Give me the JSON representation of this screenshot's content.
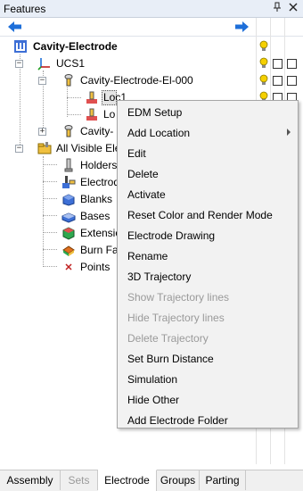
{
  "panel": {
    "title": "Features",
    "pin_icon": "pin-icon",
    "close_icon": "close-icon"
  },
  "nav": {
    "back_icon": "arrow-left-icon",
    "forward_icon": "arrow-right-icon",
    "bulb_icon": "lightbulb-icon"
  },
  "tree": {
    "root": "Cavity-Electrode",
    "ucs": "UCS1",
    "electrode_group": "Cavity-Electrode-El-000",
    "loc1": "Loc1",
    "loc2": "Lo",
    "cavity2": "Cavity-",
    "all_visible": "All Visible Ele",
    "holders": "Holders",
    "electrodes": "Electrod",
    "blanks": "Blanks",
    "bases": "Bases",
    "extensions": "Extensio",
    "burn_faces": "Burn Fa",
    "points": "Points"
  },
  "context_menu": {
    "items": [
      {
        "label": "EDM Setup",
        "enabled": true
      },
      {
        "label": "Add Location",
        "enabled": true,
        "submenu": true
      },
      {
        "label": "Edit",
        "enabled": true
      },
      {
        "label": "Delete",
        "enabled": true
      },
      {
        "label": "Activate",
        "enabled": true
      },
      {
        "label": "Reset Color and Render Mode",
        "enabled": true
      },
      {
        "label": "Electrode Drawing",
        "enabled": true
      },
      {
        "label": "Rename",
        "enabled": true
      },
      {
        "label": "3D Trajectory",
        "enabled": true
      },
      {
        "label": "Show Trajectory lines",
        "enabled": false
      },
      {
        "label": "Hide Trajectory lines",
        "enabled": false
      },
      {
        "label": "Delete Trajectory",
        "enabled": false
      },
      {
        "label": "Set Burn Distance",
        "enabled": true
      },
      {
        "label": "Simulation",
        "enabled": true
      },
      {
        "label": "Hide Other",
        "enabled": true
      },
      {
        "label": "Add Electrode Folder",
        "enabled": true
      }
    ]
  },
  "tabs": [
    {
      "label": "Assembly",
      "active": false,
      "enabled": true
    },
    {
      "label": "Sets",
      "active": false,
      "enabled": false
    },
    {
      "label": "Electrode",
      "active": true,
      "enabled": true
    },
    {
      "label": "Groups",
      "active": false,
      "enabled": true
    },
    {
      "label": "Parting",
      "active": false,
      "enabled": true
    }
  ],
  "colors": {
    "accent_blue": "#1e6fd9",
    "bulb_yellow": "#f5d000",
    "menu_bg": "#f2f2f2",
    "disabled_text": "#9a9a9a"
  }
}
